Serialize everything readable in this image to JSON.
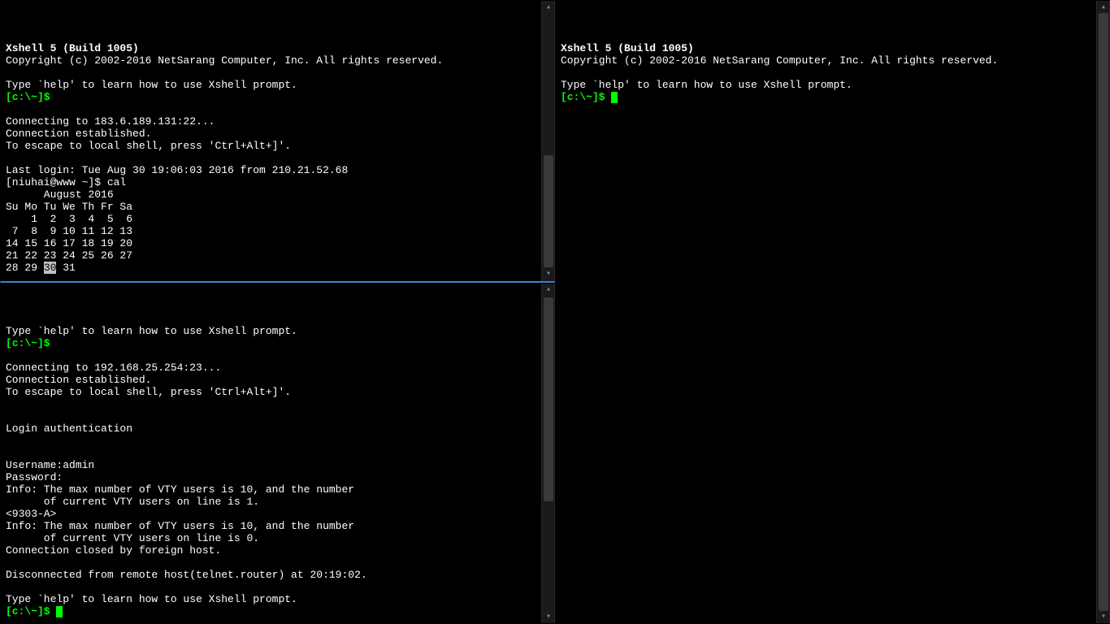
{
  "colors": {
    "green": "#00c800",
    "bright_green": "#00ff00",
    "bg": "#000000",
    "fg": "#ffffff"
  },
  "top_left": {
    "title": "Xshell 5 (Build 1005)",
    "copyright": "Copyright (c) 2002-2016 NetSarang Computer, Inc. All rights reserved.",
    "help_line": "Type `help' to learn how to use Xshell prompt.",
    "prompt": "[c:\\~]$",
    "connecting": "Connecting to 183.6.189.131:22...",
    "established": "Connection established.",
    "escape": "To escape to local shell, press 'Ctrl+Alt+]'.",
    "last_login": "Last login: Tue Aug 30 19:06:03 2016 from 210.21.52.68",
    "shell_prompt": "[niuhai@www ~]$ ",
    "cmd": "cal",
    "cal": {
      "title": "      August 2016",
      "header": "Su Mo Tu We Th Fr Sa",
      "rows": [
        "    1  2  3  4  5  6",
        " 7  8  9 10 11 12 13",
        "14 15 16 17 18 19 20",
        "21 22 23 24 25 26 27"
      ],
      "last_row_pre": "28 29 ",
      "today": "30",
      "last_row_post": " 31"
    },
    "scroll": {
      "thumb_top_pct": 55,
      "thumb_h_pct": 40
    }
  },
  "bottom_left": {
    "help_line": "Type `help' to learn how to use Xshell prompt.",
    "prompt": "[c:\\~]$",
    "connecting": "Connecting to 192.168.25.254:23...",
    "established": "Connection established.",
    "escape": "To escape to local shell, press 'Ctrl+Alt+]'.",
    "auth": "Login authentication",
    "username_line": "Username:admin",
    "password_line": "Password:",
    "info1a": "Info: The max number of VTY users is 10, and the number",
    "info1b": "      of current VTY users on line is 1.",
    "device": "<9303-A>",
    "info2a": "Info: The max number of VTY users is 10, and the number",
    "info2b": "      of current VTY users on line is 0.",
    "closed": "Connection closed by foreign host.",
    "disconnected": "Disconnected from remote host(telnet.router) at 20:19:02.",
    "help_line2": "Type `help' to learn how to use Xshell prompt.",
    "prompt2": "[c:\\~]$ ",
    "scroll": {
      "thumb_top_pct": 4,
      "thumb_h_pct": 60
    }
  },
  "right": {
    "title": "Xshell 5 (Build 1005)",
    "copyright": "Copyright (c) 2002-2016 NetSarang Computer, Inc. All rights reserved.",
    "help_line": "Type `help' to learn how to use Xshell prompt.",
    "prompt": "[c:\\~]$ ",
    "scroll": {
      "thumb_top_pct": 2,
      "thumb_h_pct": 96
    }
  }
}
